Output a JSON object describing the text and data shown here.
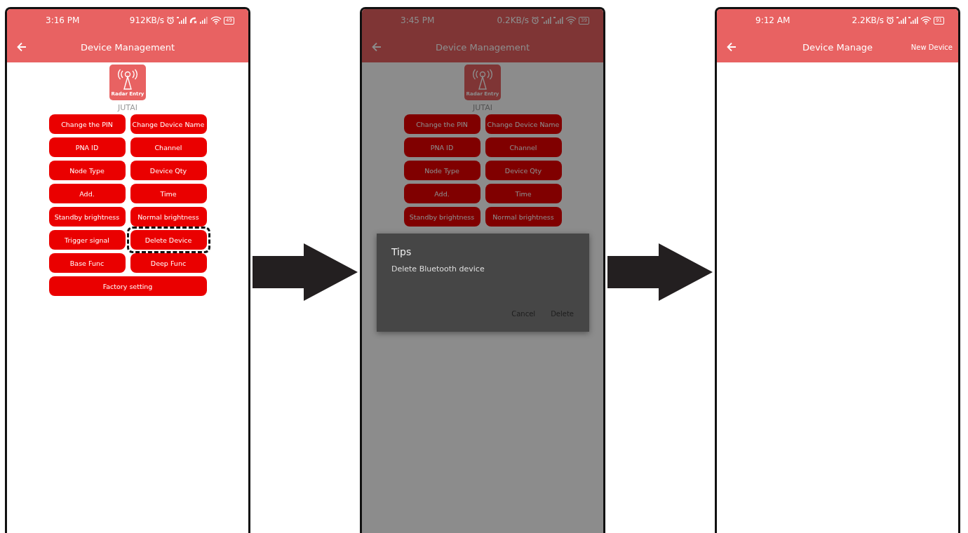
{
  "screens": [
    {
      "dimmed": false,
      "status_bar": {
        "time": "3:16 PM",
        "speed": "912KB/s",
        "call_muted": true,
        "battery": "49"
      },
      "app_bar": {
        "title": "Device Management"
      },
      "device": {
        "icon_label": "Radar Entry",
        "name": "JUTAI"
      },
      "buttons": [
        {
          "label": "Change the PIN",
          "kind": "normal",
          "highlighted": false
        },
        {
          "label": "Change Device Name",
          "kind": "normal",
          "highlighted": false
        },
        {
          "label": "PNA ID",
          "kind": "normal",
          "highlighted": false
        },
        {
          "label": "Channel",
          "kind": "normal",
          "highlighted": false
        },
        {
          "label": "Node Type",
          "kind": "normal",
          "highlighted": false
        },
        {
          "label": "Device Qty",
          "kind": "normal",
          "highlighted": false
        },
        {
          "label": "Add.",
          "kind": "normal",
          "highlighted": false
        },
        {
          "label": "Time",
          "kind": "normal",
          "highlighted": false
        },
        {
          "label": "Standby brightness",
          "kind": "normal",
          "highlighted": false
        },
        {
          "label": "Normal brightness",
          "kind": "normal",
          "highlighted": false
        },
        {
          "label": "Trigger signal",
          "kind": "normal",
          "highlighted": false
        },
        {
          "label": "Delete Device",
          "kind": "normal",
          "highlighted": true
        },
        {
          "label": "Base Func",
          "kind": "normal",
          "highlighted": false
        },
        {
          "label": "Deep Func",
          "kind": "normal",
          "highlighted": false
        },
        {
          "label": "Factory setting",
          "kind": "wide",
          "highlighted": false
        }
      ]
    },
    {
      "dimmed": true,
      "status_bar": {
        "time": "3:45 PM",
        "speed": "0.2KB/s",
        "call_muted": false,
        "battery": "39"
      },
      "app_bar": {
        "title": "Device Management"
      },
      "device": {
        "icon_label": "Radar Entry",
        "name": "JUTAI"
      },
      "buttons": [
        {
          "label": "Change the PIN",
          "kind": "normal",
          "highlighted": false
        },
        {
          "label": "Change Device Name",
          "kind": "normal",
          "highlighted": false
        },
        {
          "label": "PNA ID",
          "kind": "normal",
          "highlighted": false
        },
        {
          "label": "Channel",
          "kind": "normal",
          "highlighted": false
        },
        {
          "label": "Node Type",
          "kind": "normal",
          "highlighted": false
        },
        {
          "label": "Device Qty",
          "kind": "normal",
          "highlighted": false
        },
        {
          "label": "Add.",
          "kind": "normal",
          "highlighted": false
        },
        {
          "label": "Time",
          "kind": "normal",
          "highlighted": false
        },
        {
          "label": "Standby brightness",
          "kind": "normal",
          "highlighted": false
        },
        {
          "label": "Normal brightness",
          "kind": "normal",
          "highlighted": false
        }
      ],
      "dialog": {
        "title": "Tips",
        "message": "Delete Bluetooth device",
        "buttons": [
          "Cancel",
          "Delete"
        ]
      }
    },
    {
      "dimmed": false,
      "status_bar": {
        "time": "9:12 AM",
        "speed": "2.2KB/s",
        "call_muted": false,
        "battery": "91"
      },
      "app_bar": {
        "title": "Device Manage",
        "action": "New Device"
      }
    }
  ]
}
